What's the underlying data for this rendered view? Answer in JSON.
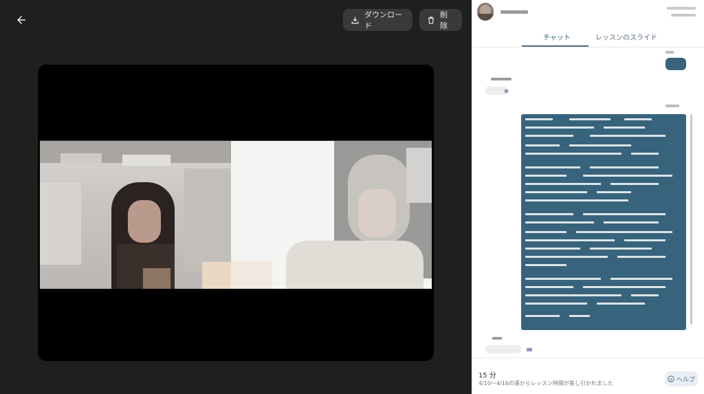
{
  "viewer": {
    "download_label": "ダウンロード",
    "delete_label": "削除",
    "icons": {
      "back": "arrow-left-icon",
      "download": "download-icon",
      "delete": "trash-icon"
    },
    "colors": {
      "background": "#1f1f1f",
      "button": "#3a3a3a",
      "video_bg": "#000000"
    }
  },
  "chat": {
    "tabs": [
      {
        "label": "チャット",
        "active": true
      },
      {
        "label": "レッスンのスライド",
        "active": false
      }
    ],
    "colors": {
      "bubble": "#37637d",
      "accent": "#4a6d86"
    },
    "footer": {
      "duration": "15 分",
      "note": "4/10〜4/16の週からレッスン時間が差し引かれました",
      "help_label": "ヘルプ"
    }
  }
}
